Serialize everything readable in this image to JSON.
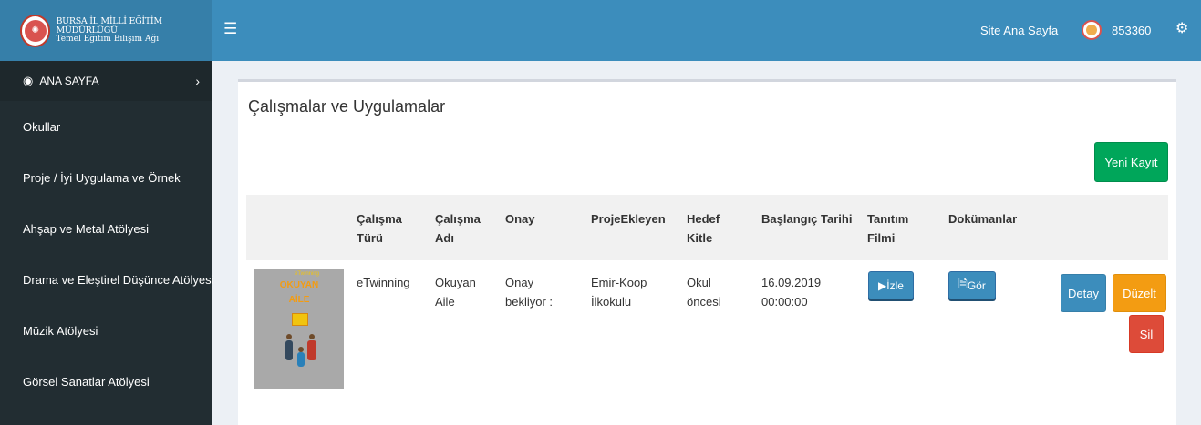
{
  "header": {
    "logo_line1": "BURSA İL MİLLİ EĞİTİM MÜDÜRLÜĞÜ",
    "logo_line2": "Temel Eğitim Bilişim Ağı",
    "menu_icon": "hamburger-icon",
    "site_home_label": "Site Ana Sayfa",
    "username": "853360",
    "settings_icon": "cogs-icon"
  },
  "sidebar": {
    "items": [
      {
        "label": "ANA SAYFA",
        "icon": "dashboard-icon"
      },
      {
        "label": "Okullar"
      },
      {
        "label": "Proje / İyi Uygulama ve Örnek"
      },
      {
        "label": "Ahşap ve Metal Atölyesi"
      },
      {
        "label": "Drama ve Eleştirel Düşünce Atölyesi"
      },
      {
        "label": "Müzik Atölyesi"
      },
      {
        "label": "Görsel Sanatlar Atölyesi"
      }
    ]
  },
  "main": {
    "title": "Çalışmalar ve Uygulamalar",
    "new_record_label": "Yeni Kayıt",
    "table": {
      "headers": {
        "type": [
          "Çalışma",
          "Türü"
        ],
        "name": [
          "Çalışma",
          "Adı"
        ],
        "approval": [
          "Onay"
        ],
        "added_by": [
          "ProjeEkleyen"
        ],
        "audience": [
          "Hedef",
          "Kitle"
        ],
        "start_date": [
          "Başlangıç Tarihi"
        ],
        "promo_film": [
          "Tanıtım",
          "Filmi"
        ],
        "documents": [
          "Dokümanlar"
        ]
      },
      "rows": [
        {
          "thumb_tiny": "eTwinning",
          "thumb_title_1": "OKUYAN",
          "thumb_title_2": "AİLE",
          "type": "eTwinning",
          "name": [
            "Okuyan",
            "Aile"
          ],
          "approval": [
            "Onay",
            "bekliyor :"
          ],
          "added_by": [
            "Emir-Koop",
            "İlkokulu"
          ],
          "audience": [
            "Okul",
            "öncesi"
          ],
          "start_date": [
            "16.09.2019",
            "00:00:00"
          ],
          "watch_label": "İzle",
          "view_label": "Gör",
          "detail_label": "Detay",
          "edit_label": "Düzelt",
          "delete_label": "Sil"
        }
      ]
    }
  },
  "colors": {
    "header": "#3c8dbc",
    "logo_bg": "#367fa9",
    "sidebar": "#222d32",
    "success": "#00a65a",
    "warning": "#f39c12",
    "danger": "#dd4b39",
    "primary": "#3c8dbc"
  }
}
